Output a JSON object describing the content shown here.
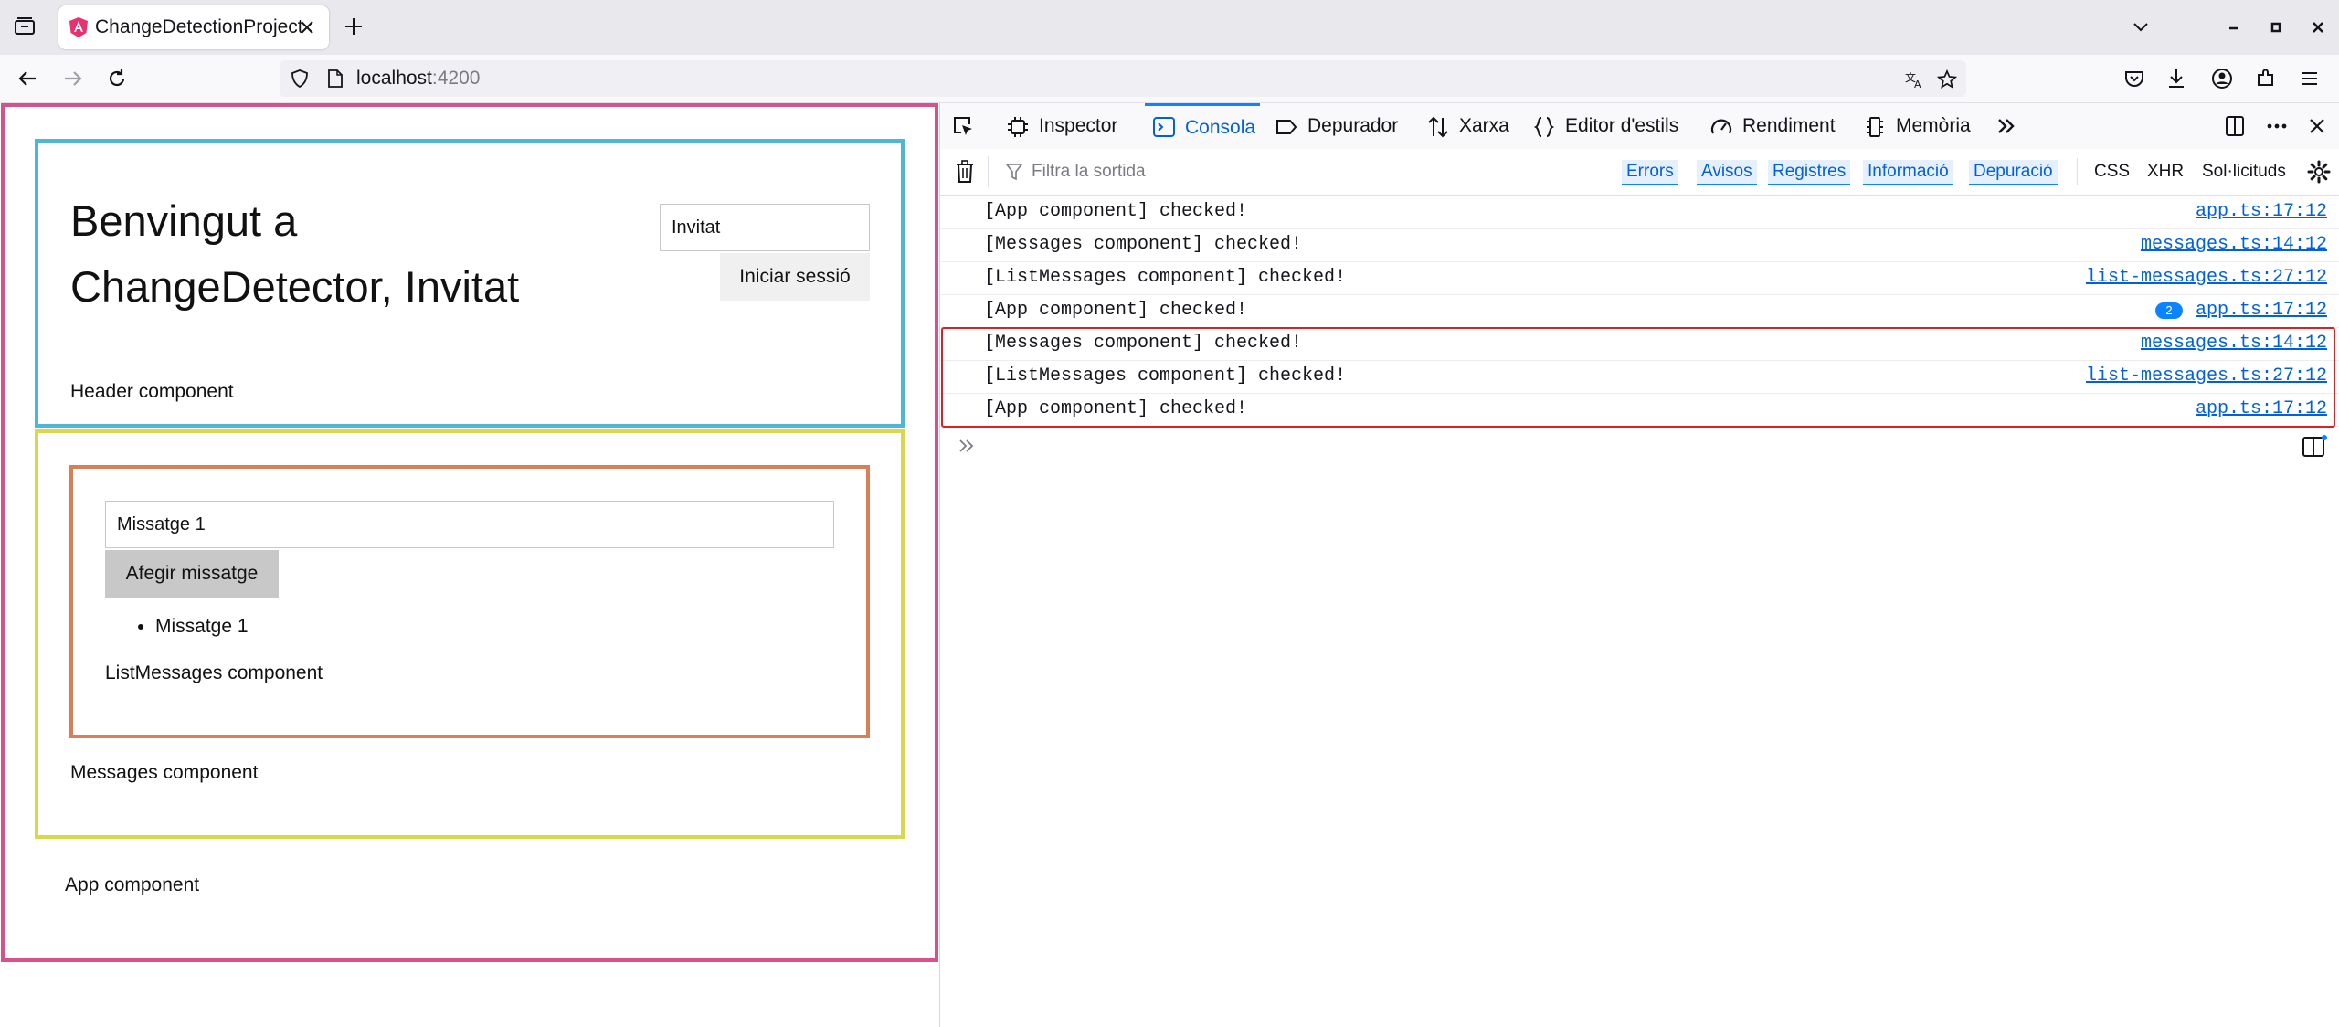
{
  "browser": {
    "tab_title": "ChangeDetectionProject",
    "url_host": "localhost",
    "url_port": ":4200"
  },
  "app": {
    "welcome_text": "Benvingut a ChangeDetector, Invitat",
    "login_input_value": "Invitat",
    "login_button": "Iniciar sessió",
    "header_label": "Header component",
    "message_input_value": "Missatge 1",
    "add_button": "Afegir missatge",
    "messages": [
      "Missatge 1"
    ],
    "list_label": "ListMessages component",
    "messages_label": "Messages component",
    "app_label": "App component"
  },
  "devtools": {
    "tabs": [
      {
        "label": "Inspector",
        "icon": "inspector-icon"
      },
      {
        "label": "Consola",
        "icon": "console-icon",
        "active": true
      },
      {
        "label": "Depurador",
        "icon": "debugger-icon"
      },
      {
        "label": "Xarxa",
        "icon": "network-icon"
      },
      {
        "label": "Editor d'estils",
        "icon": "style-editor-icon"
      },
      {
        "label": "Rendiment",
        "icon": "performance-icon"
      },
      {
        "label": "Memòria",
        "icon": "memory-icon"
      }
    ],
    "filter_placeholder": "Filtra la sortida",
    "filters_on": [
      "Errors",
      "Avisos",
      "Registres",
      "Informació",
      "Depuració"
    ],
    "filters_off": [
      "CSS",
      "XHR",
      "Sol·licituds"
    ],
    "logs": [
      {
        "text": "[App component] checked!",
        "source": "app.ts:17:12"
      },
      {
        "text": "[Messages component] checked!",
        "source": "messages.ts:14:12"
      },
      {
        "text": "[ListMessages component] checked!",
        "source": "list-messages.ts:27:12"
      },
      {
        "text": "[App component] checked!",
        "source": "app.ts:17:12",
        "repeat": "2"
      },
      {
        "text": "[Messages component] checked!",
        "source": "messages.ts:14:12"
      },
      {
        "text": "[ListMessages component] checked!",
        "source": "list-messages.ts:27:12"
      },
      {
        "text": "[App component] checked!",
        "source": "app.ts:17:12"
      }
    ],
    "accent_color": "#0a84ff"
  },
  "colors": {
    "app_border": "#d6518e",
    "header_border": "#4fb7d6",
    "messages_border": "#d9d84c",
    "list_border": "#d97f57",
    "highlight_border": "#e02020"
  }
}
